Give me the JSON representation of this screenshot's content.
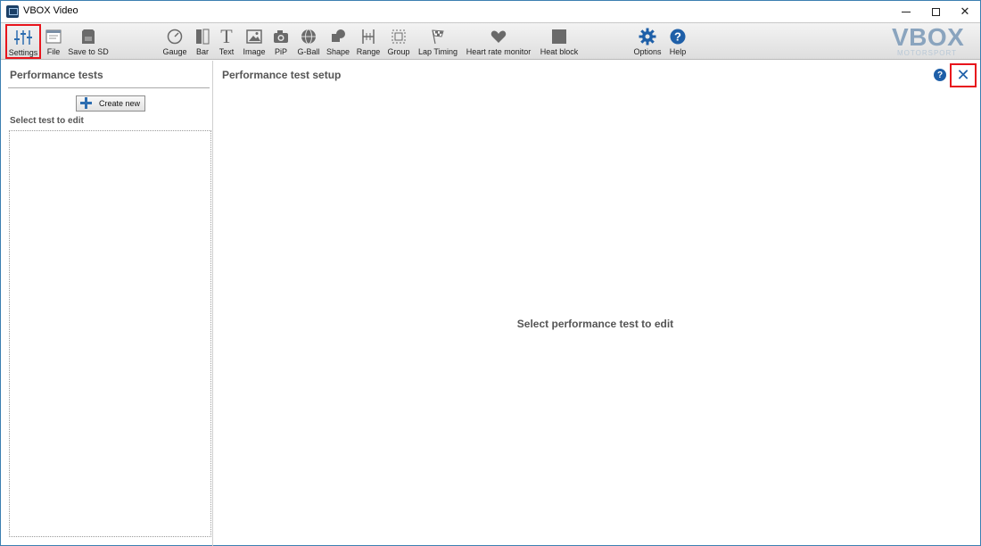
{
  "window": {
    "title": "VBOX Video"
  },
  "toolbar": {
    "items": [
      {
        "label": "Settings",
        "icon": "sliders-icon"
      },
      {
        "label": "File",
        "icon": "file-icon"
      },
      {
        "label": "Save to SD",
        "icon": "sd-card-icon"
      },
      {
        "label": "Gauge",
        "icon": "gauge-icon"
      },
      {
        "label": "Bar",
        "icon": "bar-icon"
      },
      {
        "label": "Text",
        "icon": "text-icon"
      },
      {
        "label": "Image",
        "icon": "image-icon"
      },
      {
        "label": "PiP",
        "icon": "camera-icon"
      },
      {
        "label": "G-Ball",
        "icon": "g-ball-icon"
      },
      {
        "label": "Shape",
        "icon": "shape-icon"
      },
      {
        "label": "Range",
        "icon": "range-icon"
      },
      {
        "label": "Group",
        "icon": "group-icon"
      },
      {
        "label": "Lap Timing",
        "icon": "checkered-flag-icon"
      },
      {
        "label": "Heart rate monitor",
        "icon": "heart-icon"
      },
      {
        "label": "Heat block",
        "icon": "heat-block-icon"
      },
      {
        "label": "Options",
        "icon": "gear-icon"
      },
      {
        "label": "Help",
        "icon": "help-icon"
      }
    ],
    "logo": {
      "main": "VBOX",
      "sub": "MOTORSPORT"
    }
  },
  "left_panel": {
    "title": "Performance tests",
    "create_label": "Create new",
    "select_label": "Select test to edit"
  },
  "right_panel": {
    "title": "Performance test setup",
    "help_glyph": "?",
    "close_glyph": "✕",
    "empty_message": "Select performance test to edit"
  },
  "colors": {
    "accent": "#1e5fa8",
    "highlight": "#e8141c",
    "logo": "#8aa4be"
  }
}
